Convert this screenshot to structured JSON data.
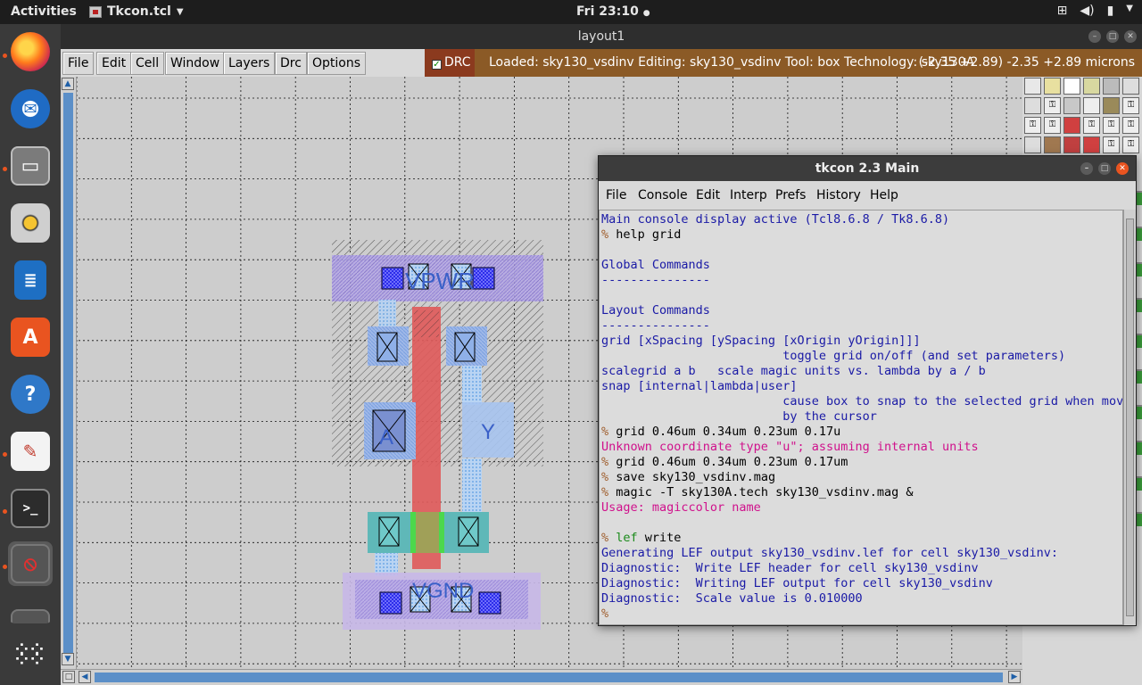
{
  "topbar": {
    "activities": "Activities",
    "app_name": "Tkcon.tcl",
    "clock": "Fri 23:10"
  },
  "dock": {
    "items": [
      {
        "name": "firefox",
        "icon": "firefox-icon"
      },
      {
        "name": "thunderbird",
        "icon": "mail-icon"
      },
      {
        "name": "files",
        "icon": "files-icon"
      },
      {
        "name": "rhythmbox",
        "icon": "speaker-icon"
      },
      {
        "name": "writer",
        "icon": "document-icon"
      },
      {
        "name": "software",
        "icon": "store-icon"
      },
      {
        "name": "help",
        "icon": "help-icon"
      },
      {
        "name": "text-editor",
        "icon": "notepad-icon"
      },
      {
        "name": "terminal",
        "icon": "terminal-icon"
      },
      {
        "name": "magic",
        "icon": "no-entry-icon"
      },
      {
        "name": "magic-2",
        "icon": "no-entry-icon"
      },
      {
        "name": "show-apps",
        "icon": "grid-icon"
      }
    ]
  },
  "magic": {
    "window_title": "layout1",
    "menus": [
      "File",
      "Edit",
      "Cell",
      "Window",
      "Layers",
      "Drc",
      "Options"
    ],
    "drc_label": "DRC",
    "status_message": "Loaded: sky130_vsdinv Editing: sky130_vsdinv Tool: box  Technology: sky130A",
    "coords": "(-2.35 +2.89) -2.35 +2.89 microns",
    "labels": {
      "vpwr": "VPWR",
      "vgnd": "VGND",
      "a": "A",
      "y": "Y"
    }
  },
  "tkcon": {
    "title": "tkcon 2.3 Main",
    "menus": [
      "File",
      "Console",
      "Edit",
      "Interp",
      "Prefs",
      "History",
      "Help"
    ],
    "lines": [
      {
        "t": "Main console display active (Tcl8.6.8 / Tk8.6.8)",
        "c": "blue"
      },
      {
        "p": "% ",
        "t": "help grid",
        "c": "black"
      },
      {
        "t": "",
        "c": "black"
      },
      {
        "t": "Global Commands",
        "c": "blue"
      },
      {
        "t": "---------------",
        "c": "blue"
      },
      {
        "t": "",
        "c": "black"
      },
      {
        "t": "Layout Commands",
        "c": "blue"
      },
      {
        "t": "---------------",
        "c": "blue"
      },
      {
        "t": "grid [xSpacing [ySpacing [xOrigin yOrigin]]]",
        "c": "blue"
      },
      {
        "t": "                         toggle grid on/off (and set parameters)",
        "c": "blue"
      },
      {
        "t": "scalegrid a b   scale magic units vs. lambda by a / b",
        "c": "blue"
      },
      {
        "t": "snap [internal|lambda|user]",
        "c": "blue"
      },
      {
        "t": "                         cause box to snap to the selected grid when moved",
        "c": "blue"
      },
      {
        "t": "                         by the cursor",
        "c": "blue"
      },
      {
        "p": "% ",
        "t": "grid 0.46um 0.34um 0.23um 0.17u",
        "c": "black"
      },
      {
        "t": "Unknown coordinate type \"u\"; assuming internal units",
        "c": "mag"
      },
      {
        "p": "% ",
        "t": "grid 0.46um 0.34um 0.23um 0.17um",
        "c": "black"
      },
      {
        "p": "% ",
        "t": "save sky130_vsdinv.mag",
        "c": "black"
      },
      {
        "p": "% ",
        "t": "magic -T sky130A.tech sky130_vsdinv.mag &",
        "c": "black"
      },
      {
        "t": "Usage: magiccolor name",
        "c": "mag"
      },
      {
        "t": "",
        "c": "black"
      },
      {
        "p": "% ",
        "k": "lef",
        "t": " write",
        "c": "black"
      },
      {
        "t": "Generating LEF output sky130_vsdinv.lef for cell sky130_vsdinv:",
        "c": "blue"
      },
      {
        "t": "Diagnostic:  Write LEF header for cell sky130_vsdinv",
        "c": "blue"
      },
      {
        "t": "Diagnostic:  Writing LEF output for cell sky130_vsdinv",
        "c": "blue"
      },
      {
        "t": "Diagnostic:  Scale value is 0.010000",
        "c": "blue"
      },
      {
        "p": "%",
        "t": "",
        "c": "black"
      }
    ]
  }
}
